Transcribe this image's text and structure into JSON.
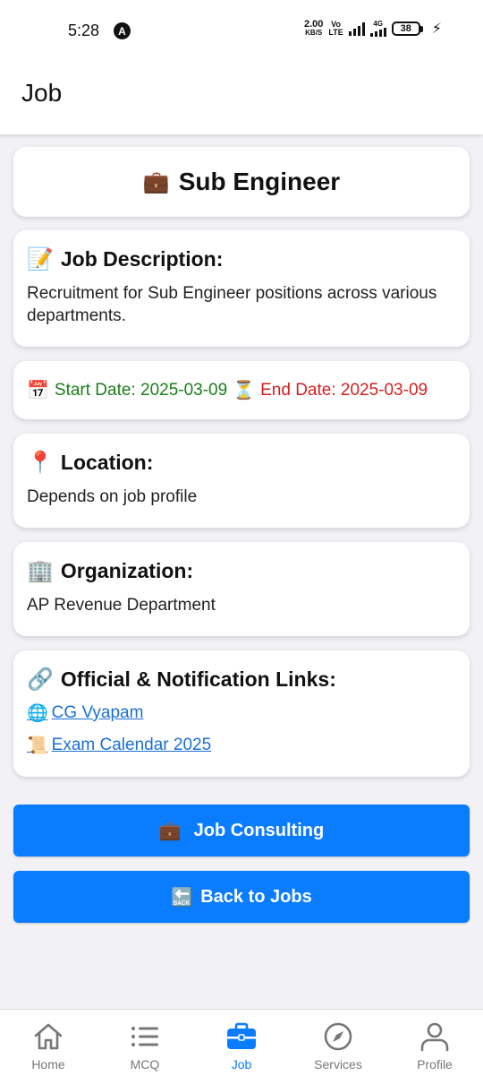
{
  "status": {
    "time": "5:28",
    "a_glyph": "ᴀ",
    "speed_top": "2.00",
    "speed_bottom": "KB/S",
    "volte_top": "Vo",
    "volte_bottom": "LTE",
    "net": "4G",
    "battery": "38"
  },
  "appbar": {
    "title": "Job"
  },
  "job": {
    "title": "Sub Engineer",
    "title_emoji": "💼",
    "description_heading": "Job Description:",
    "description_emoji": "📝",
    "description": "Recruitment for Sub Engineer positions across various departments.",
    "start_emoji": "📅",
    "start_date": "Start Date: 2025-03-09",
    "end_emoji": "⏳",
    "end_date": "End Date: 2025-03-09",
    "location_heading": "Location:",
    "location_emoji": "📍",
    "location": "Depends on job profile",
    "organization_heading": "Organization:",
    "organization_emoji": "🏢",
    "organization": "AP Revenue Department",
    "links_heading": "Official & Notification Links:",
    "links_emoji": "🔗",
    "links": [
      {
        "emoji": "🌐",
        "label": "CG Vyapam"
      },
      {
        "emoji": "📜",
        "label": "Exam Calendar 2025"
      }
    ]
  },
  "buttons": {
    "consulting_emoji": "💼",
    "consulting": "Job Consulting",
    "back_emoji": "🔙",
    "back": "Back to Jobs"
  },
  "tabs": [
    {
      "label": "Home",
      "icon": "home-icon"
    },
    {
      "label": "MCQ",
      "icon": "list-icon"
    },
    {
      "label": "Job",
      "icon": "briefcase-icon",
      "active": true
    },
    {
      "label": "Services",
      "icon": "compass-icon"
    },
    {
      "label": "Profile",
      "icon": "person-icon"
    }
  ],
  "colors": {
    "accent": "#0a7cff",
    "start": "#1a7f1a",
    "end": "#d61f1f",
    "link": "#1b6fd6"
  }
}
